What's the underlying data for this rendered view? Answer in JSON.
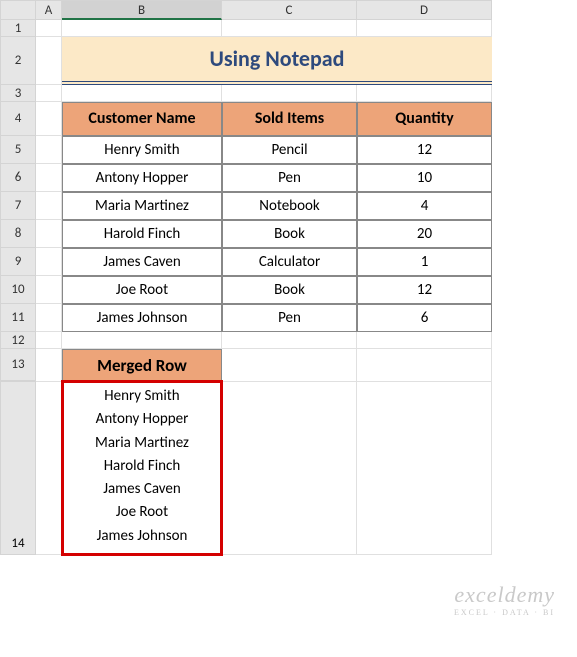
{
  "columns": [
    "",
    "A",
    "B",
    "C",
    "D"
  ],
  "row_numbers": [
    1,
    2,
    3,
    4,
    5,
    6,
    7,
    8,
    9,
    10,
    11,
    12,
    13,
    14
  ],
  "selected_column": "B",
  "title": "Using Notepad",
  "table": {
    "headers": [
      "Customer Name",
      "Sold Items",
      "Quantity"
    ],
    "rows": [
      [
        "Henry Smith",
        "Pencil",
        "12"
      ],
      [
        "Antony Hopper",
        "Pen",
        "10"
      ],
      [
        "Maria Martinez",
        "Notebook",
        "4"
      ],
      [
        "Harold Finch",
        "Book",
        "20"
      ],
      [
        "James Caven",
        "Calculator",
        "1"
      ],
      [
        "Joe Root",
        "Book",
        "12"
      ],
      [
        "James Johnson",
        "Pen",
        "6"
      ]
    ]
  },
  "merged": {
    "header": "Merged Row",
    "lines": [
      "Henry Smith",
      "Antony Hopper",
      "Maria Martinez",
      "Harold Finch",
      "James Caven",
      "Joe Root",
      "James Johnson"
    ]
  },
  "watermark": {
    "brand": "exceldemy",
    "tagline": "EXCEL · DATA · BI"
  },
  "chart_data": {
    "type": "table",
    "title": "Using Notepad",
    "columns": [
      "Customer Name",
      "Sold Items",
      "Quantity"
    ],
    "rows": [
      {
        "Customer Name": "Henry Smith",
        "Sold Items": "Pencil",
        "Quantity": 12
      },
      {
        "Customer Name": "Antony Hopper",
        "Sold Items": "Pen",
        "Quantity": 10
      },
      {
        "Customer Name": "Maria Martinez",
        "Sold Items": "Notebook",
        "Quantity": 4
      },
      {
        "Customer Name": "Harold Finch",
        "Sold Items": "Book",
        "Quantity": 20
      },
      {
        "Customer Name": "James Caven",
        "Sold Items": "Calculator",
        "Quantity": 1
      },
      {
        "Customer Name": "Joe Root",
        "Sold Items": "Book",
        "Quantity": 12
      },
      {
        "Customer Name": "James Johnson",
        "Sold Items": "Pen",
        "Quantity": 6
      }
    ]
  }
}
